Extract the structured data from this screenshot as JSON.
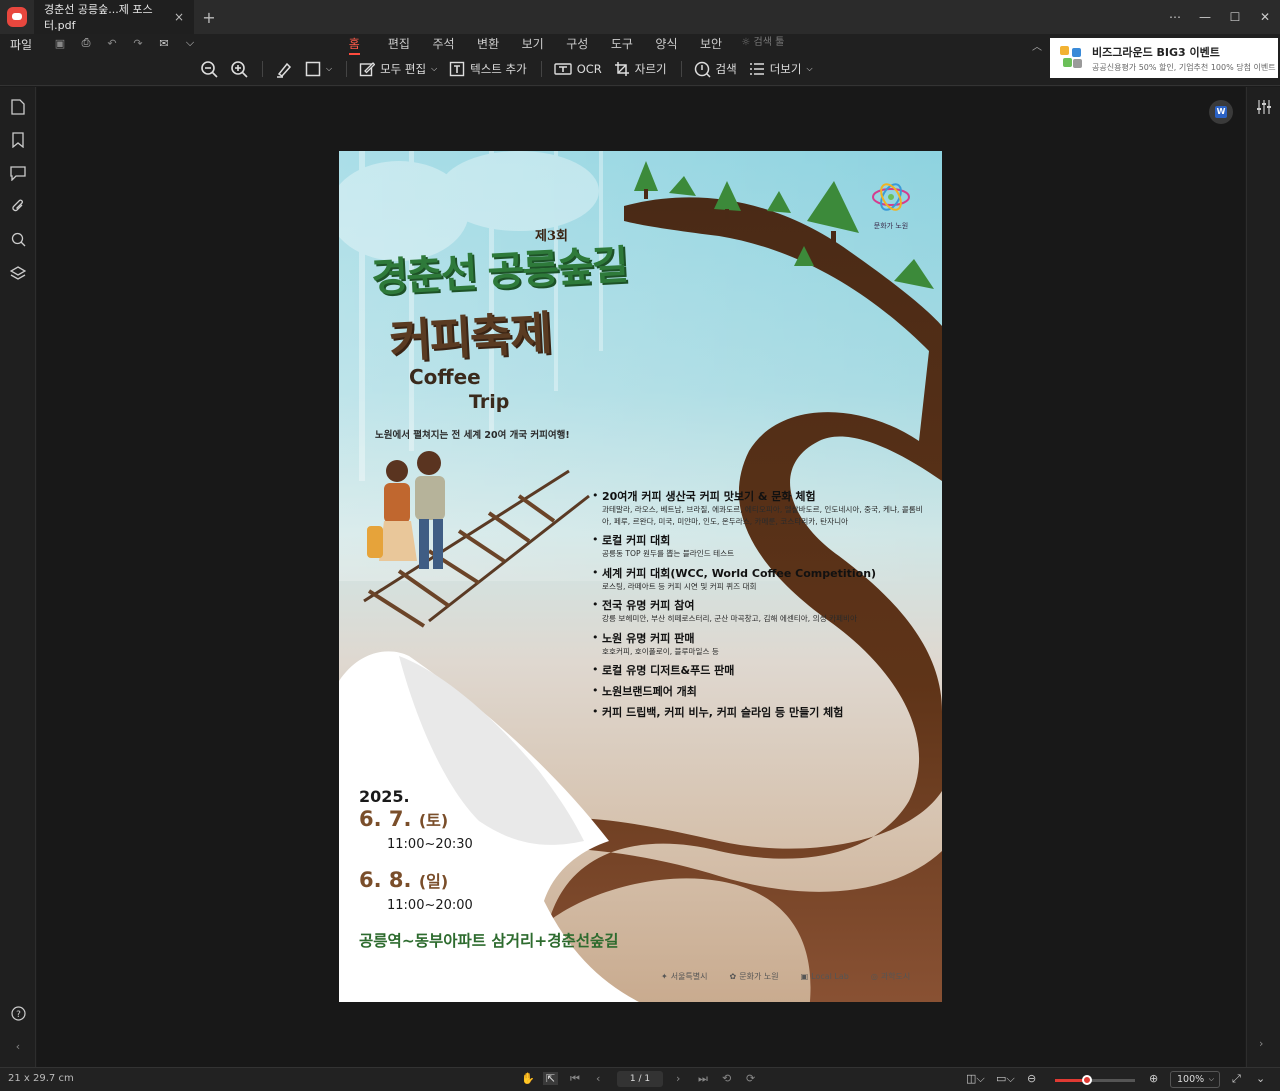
{
  "window": {
    "tab_title": "경춘선 공릉숲...제 포스터.pdf",
    "controls": [
      "⋯",
      "—",
      "☐",
      "✕"
    ]
  },
  "menu": {
    "file": "파일",
    "tabs": [
      "홈",
      "편집",
      "주석",
      "변환",
      "보기",
      "구성",
      "도구",
      "양식",
      "보안"
    ],
    "active_tab": "홈",
    "search_tool": "검색 툴"
  },
  "toolbar": {
    "edit_all": "모두 편집",
    "add_text": "텍스트 추가",
    "ocr": "OCR",
    "crop": "자르기",
    "search": "검색",
    "more": "더보기"
  },
  "ad": {
    "title": "비즈그라운드 BIG3 이벤트",
    "subtitle": "공공신용평가 50% 할인, 기업추천 100% 당첨 이벤트"
  },
  "status": {
    "page_size": "21 x 29.7 cm",
    "page_indicator": "1 / 1",
    "zoom": "100%",
    "zoom_level": 0.4
  },
  "poster": {
    "edition": "제3회",
    "title_line1": "경춘선 공릉숲길",
    "title_line2": "커피축제",
    "coffee": "Coffee",
    "trip": "Trip",
    "tagline": "노원에서 펼쳐지는 전 세계 20여 개국 커피여행!",
    "seal_text": "문화가 노원",
    "items": [
      {
        "title": "20여개 커피 생산국 커피 맛보기 & 문화 체험",
        "desc": "과테말라, 라오스, 베트남, 브라질, 에콰도르, 에티오피아, 엘살바도르, 인도네시아, 중국, 케냐, 콜롬비아, 페루, 르완다, 미국, 미얀마, 인도, 온두라스, 카메룬, 코스타리카, 탄자니아"
      },
      {
        "title": "로컬 커피 대회",
        "desc": "공릉동 TOP 원두를 뽑는 블라인드 테스트"
      },
      {
        "title": "세계 커피 대회(WCC, World Coffee Competition)",
        "desc": "로스팅, 라떼아트 등 커피 시연 및 커피 퀴즈 대회"
      },
      {
        "title": "전국 유명 커피 참여",
        "desc": "강릉 보헤미안, 부산 히떼로스터리, 군산 마곡창고, 김해 에센티아, 의성 카페비아"
      },
      {
        "title": "노원 유명 커피 판매",
        "desc": "호호커피, 호이폴로이, 블루마일스 등"
      },
      {
        "title": "로컬 유명 디저트&푸드 판매",
        "desc": ""
      },
      {
        "title": "노원브랜드페어 개최",
        "desc": ""
      },
      {
        "title": "커피 드립백, 커피 비누, 커피 슬라임 등 만들기 체험",
        "desc": ""
      }
    ],
    "year": "2025.",
    "day1_date": "6. 7.",
    "day1_dow": "(토)",
    "day1_time": "11:00~20:30",
    "day2_date": "6. 8.",
    "day2_dow": "(일)",
    "day2_time": "11:00~20:00",
    "place": "공릉역~동부아파트 삼거리+경춘선숲길",
    "logos": [
      "서울특별시",
      "문화가 노원",
      "Local Lab",
      "과학도시"
    ]
  }
}
